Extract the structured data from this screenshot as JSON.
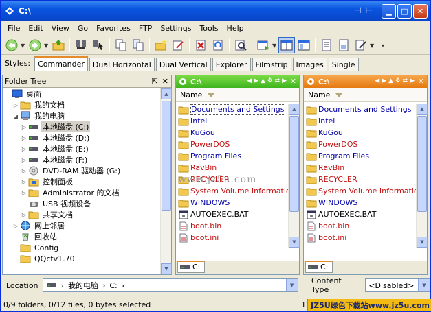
{
  "window": {
    "title": "C:\\"
  },
  "menu": [
    "File",
    "Edit",
    "View",
    "Go",
    "Favorites",
    "FTP",
    "Settings",
    "Tools",
    "Help"
  ],
  "toolbar_icons": [
    "back-icon",
    "forward-icon",
    "up-folder-icon",
    "find-icon",
    "search-icon",
    "copy-icon",
    "move-icon",
    "new-folder-icon",
    "rename-icon",
    "delete-icon",
    "undo-icon",
    "properties-icon",
    "console-icon",
    "dual-pane-icon",
    "single-pane-icon",
    "list-icon",
    "view-icon",
    "edit-icon"
  ],
  "styles": {
    "label": "Styles:",
    "tabs": [
      "Commander",
      "Dual Horizontal",
      "Dual Vertical",
      "Explorer",
      "Filmstrip",
      "Images",
      "Single"
    ],
    "active": "Commander"
  },
  "tree": {
    "title": "Folder Tree",
    "nodes": [
      {
        "label": "桌面",
        "indent": 0,
        "exp": "",
        "icon": "desktop-icon"
      },
      {
        "label": "我的文档",
        "indent": 1,
        "exp": "▷",
        "icon": "folder-icon"
      },
      {
        "label": "我的电脑",
        "indent": 1,
        "exp": "◢",
        "icon": "computer-icon"
      },
      {
        "label": "本地磁盘 (C:)",
        "indent": 2,
        "exp": "▷",
        "icon": "drive-icon",
        "selected": true
      },
      {
        "label": "本地磁盘 (D:)",
        "indent": 2,
        "exp": "▷",
        "icon": "drive-icon"
      },
      {
        "label": "本地磁盘 (E:)",
        "indent": 2,
        "exp": "▷",
        "icon": "drive-icon"
      },
      {
        "label": "本地磁盘 (F:)",
        "indent": 2,
        "exp": "▷",
        "icon": "drive-icon"
      },
      {
        "label": "DVD-RAM 驱动器 (G:)",
        "indent": 2,
        "exp": "▷",
        "icon": "dvd-icon"
      },
      {
        "label": "控制面板",
        "indent": 2,
        "exp": "▷",
        "icon": "control-panel-icon"
      },
      {
        "label": "Administrator 的文档",
        "indent": 2,
        "exp": "▷",
        "icon": "folder-icon"
      },
      {
        "label": "USB 视频设备",
        "indent": 2,
        "exp": "",
        "icon": "camera-icon"
      },
      {
        "label": "共享文档",
        "indent": 2,
        "exp": "▷",
        "icon": "folder-icon"
      },
      {
        "label": "网上邻居",
        "indent": 1,
        "exp": "▷",
        "icon": "network-icon"
      },
      {
        "label": "回收站",
        "indent": 1,
        "exp": "",
        "icon": "recycle-bin-icon"
      },
      {
        "label": "Config",
        "indent": 1,
        "exp": "",
        "icon": "folder-icon"
      },
      {
        "label": "QQctv1.70",
        "indent": 1,
        "exp": "",
        "icon": "folder-icon"
      }
    ]
  },
  "left_pane": {
    "path": "C:\\",
    "column": "Name",
    "drive_tab": "C:",
    "files": [
      {
        "name": "Documents and Settings",
        "color": "blue",
        "icon": "folder-icon",
        "focus": true
      },
      {
        "name": "Intel",
        "color": "blue",
        "icon": "folder-icon"
      },
      {
        "name": "KuGou",
        "color": "blue",
        "icon": "folder-icon"
      },
      {
        "name": "PowerDOS",
        "color": "red",
        "icon": "folder-icon"
      },
      {
        "name": "Program Files",
        "color": "blue",
        "icon": "folder-icon"
      },
      {
        "name": "RavBin",
        "color": "red",
        "icon": "folder-icon"
      },
      {
        "name": "RECYCLER",
        "color": "red",
        "icon": "folder-icon"
      },
      {
        "name": "System Volume Information",
        "color": "red",
        "icon": "folder-icon"
      },
      {
        "name": "WINDOWS",
        "color": "blue",
        "icon": "folder-icon"
      },
      {
        "name": "AUTOEXEC.BAT",
        "color": "black",
        "icon": "bat-file-icon"
      },
      {
        "name": "boot.bin",
        "color": "red",
        "icon": "file-icon"
      },
      {
        "name": "boot.ini",
        "color": "red",
        "icon": "file-icon"
      }
    ]
  },
  "right_pane": {
    "path": "C:\\",
    "column": "Name",
    "drive_tab": "C:",
    "files": [
      {
        "name": "Documents and Settings",
        "color": "blue",
        "icon": "folder-icon"
      },
      {
        "name": "Intel",
        "color": "blue",
        "icon": "folder-icon"
      },
      {
        "name": "KuGou",
        "color": "blue",
        "icon": "folder-icon"
      },
      {
        "name": "PowerDOS",
        "color": "red",
        "icon": "folder-icon"
      },
      {
        "name": "Program Files",
        "color": "blue",
        "icon": "folder-icon"
      },
      {
        "name": "RavBin",
        "color": "red",
        "icon": "folder-icon"
      },
      {
        "name": "RECYCLER",
        "color": "red",
        "icon": "folder-icon"
      },
      {
        "name": "System Volume Information",
        "color": "red",
        "icon": "folder-icon"
      },
      {
        "name": "WINDOWS",
        "color": "blue",
        "icon": "folder-icon"
      },
      {
        "name": "AUTOEXEC.BAT",
        "color": "black",
        "icon": "bat-file-icon"
      },
      {
        "name": "boot.bin",
        "color": "red",
        "icon": "file-icon"
      },
      {
        "name": "boot.ini",
        "color": "red",
        "icon": "file-icon"
      }
    ]
  },
  "location": {
    "label": "Location",
    "crumbs": [
      "我的电脑",
      "C:"
    ],
    "sep": "›"
  },
  "content_type": {
    "label": "Content Type",
    "value": "<Disabled>"
  },
  "status": {
    "text": "0/9 folders, 0/12 files, 0 bytes selected",
    "right": "12"
  },
  "watermark": "www.jz5u.com",
  "badge": "JZ5U绿色下载站www.jz5u.com",
  "colors": {
    "folder": "#f2c94c",
    "blue": "#0000a8",
    "red": "#c21414",
    "left_head": "#3fb41f",
    "right_head": "#e57a10"
  }
}
